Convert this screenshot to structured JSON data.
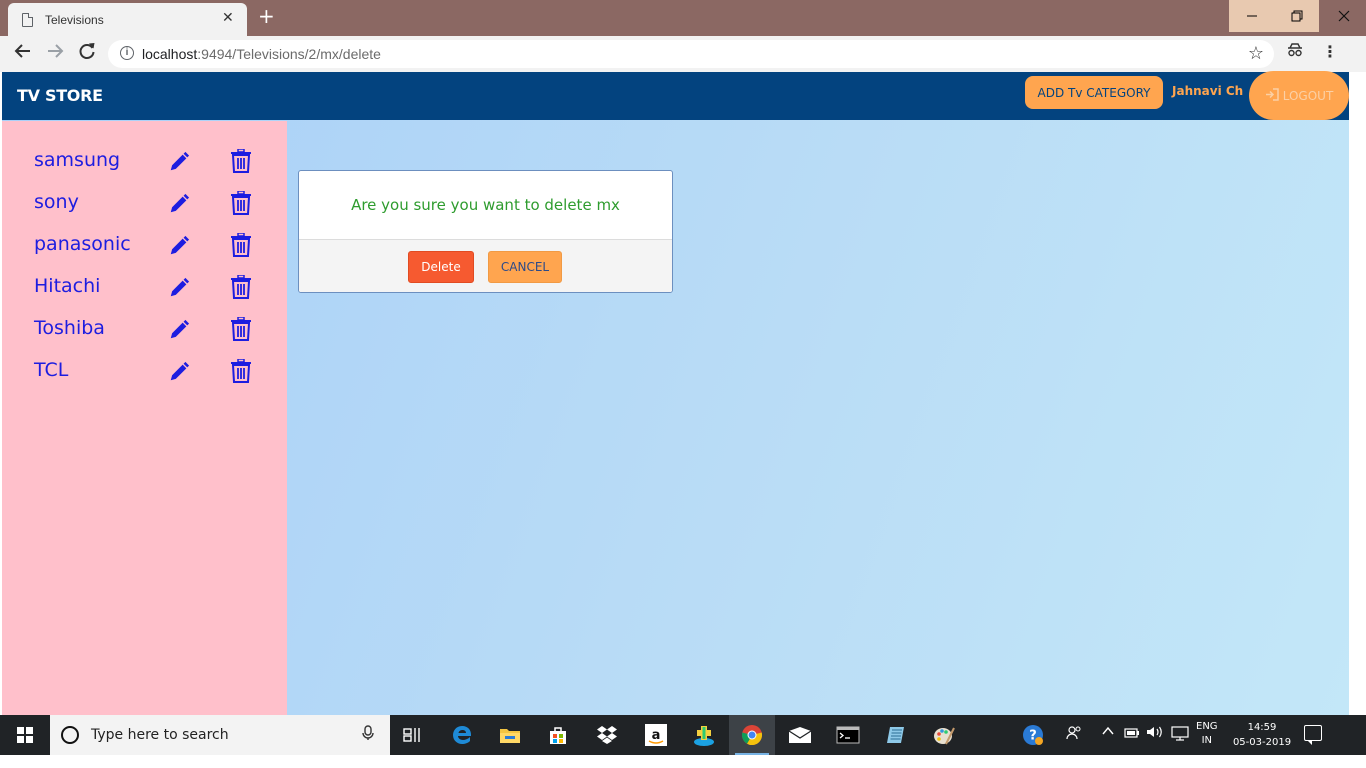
{
  "browser": {
    "tab_title": "Televisions",
    "tab_close": "✕",
    "new_tab": "+",
    "url_host": "localhost",
    "url_path": ":9494/Televisions/2/mx/delete"
  },
  "navbar": {
    "brand": "TV STORE",
    "add_category_label": "ADD Tv CATEGORY",
    "username": "Jahnavi Ch",
    "logout_label": "LOGOUT"
  },
  "sidebar": {
    "items": [
      {
        "label": "samsung"
      },
      {
        "label": "sony"
      },
      {
        "label": "panasonic"
      },
      {
        "label": "Hitachi"
      },
      {
        "label": "Toshiba"
      },
      {
        "label": "TCL"
      }
    ]
  },
  "modal": {
    "message": "Are you sure you want to delete mx",
    "delete_label": "Delete",
    "cancel_label": "CANCEL"
  },
  "taskbar": {
    "search_placeholder": "Type here to search",
    "lang_top": "ENG",
    "lang_bottom": "IN",
    "time": "14:59",
    "date": "05-03-2019"
  },
  "colors": {
    "navbar": "#03437f",
    "accent": "#ffa54f",
    "sidebar": "#ffc0cb",
    "brand_text": "#1d1de0",
    "delete_button": "#f65a30",
    "modal_text": "#2e9c2e"
  },
  "icons": [
    "page-icon",
    "back-arrow-icon",
    "forward-arrow-icon",
    "reload-icon",
    "info-icon",
    "star-icon",
    "extension-icon",
    "menu-icon",
    "pencil-icon",
    "trash-icon",
    "logout-icon",
    "windows-icon",
    "cortana-icon",
    "microphone-icon"
  ]
}
